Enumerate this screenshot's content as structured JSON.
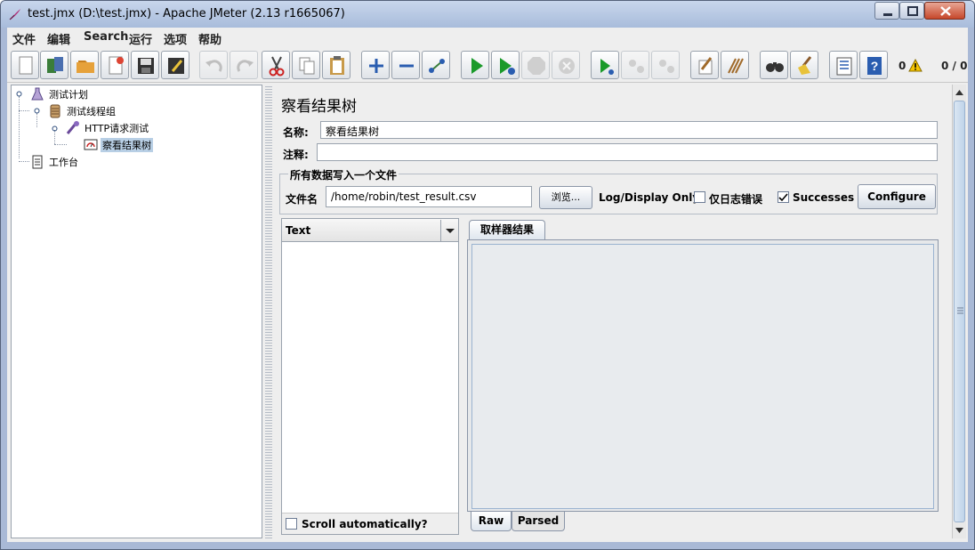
{
  "window": {
    "title": "test.jmx (D:\\test.jmx) - Apache JMeter (2.13 r1665067)"
  },
  "menu": [
    "文件",
    "编辑",
    "Search",
    "运行",
    "选项",
    "帮助"
  ],
  "toolbar": {
    "buttons": [
      "new-icon",
      "templates-icon",
      "open-icon",
      "close-icon",
      "save-icon",
      "save-as-icon",
      "undo-icon",
      "redo-icon",
      "cut-icon",
      "copy-icon",
      "paste-icon",
      "expand-icon",
      "collapse-icon",
      "toggle-icon",
      "start-icon",
      "start-no-pause-icon",
      "stop-icon",
      "shutdown-icon",
      "remote-start-icon",
      "remote-stop-icon",
      "remote-shutdown-icon",
      "clear-icon",
      "clear-all-icon",
      "search-icon",
      "reset-search-icon",
      "function-helper-icon",
      "help-icon"
    ],
    "error_count": "0",
    "thread_count": "0 / 0"
  },
  "tree": {
    "nodes": [
      {
        "label": "测试计划",
        "icon": "test-plan-icon"
      },
      {
        "label": "测试线程组",
        "icon": "thread-group-icon"
      },
      {
        "label": "HTTP请求测试",
        "icon": "http-sampler-icon"
      },
      {
        "label": "察看结果树",
        "icon": "result-tree-icon"
      },
      {
        "label": "工作台",
        "icon": "workbench-icon"
      }
    ]
  },
  "panel": {
    "title": "察看结果树",
    "name_label": "名称:",
    "name_value": "察看结果树",
    "comment_label": "注释:",
    "comment_value": "",
    "file_section_title": "所有数据写入一个文件",
    "filename_label": "文件名",
    "filename_value": "/home/robin/test_result.csv",
    "browse_label": "浏览...",
    "log_display_label": "Log/Display Only:",
    "errors_label": "仅日志错误",
    "errors_checked": false,
    "successes_label": "Successes",
    "successes_checked": true,
    "configure_label": "Configure",
    "renderer_value": "Text",
    "scroll_auto_label": "Scroll automatically?",
    "scroll_auto_checked": false,
    "result_tab_label": "取样器结果",
    "raw_tab_label": "Raw",
    "parsed_tab_label": "Parsed"
  }
}
